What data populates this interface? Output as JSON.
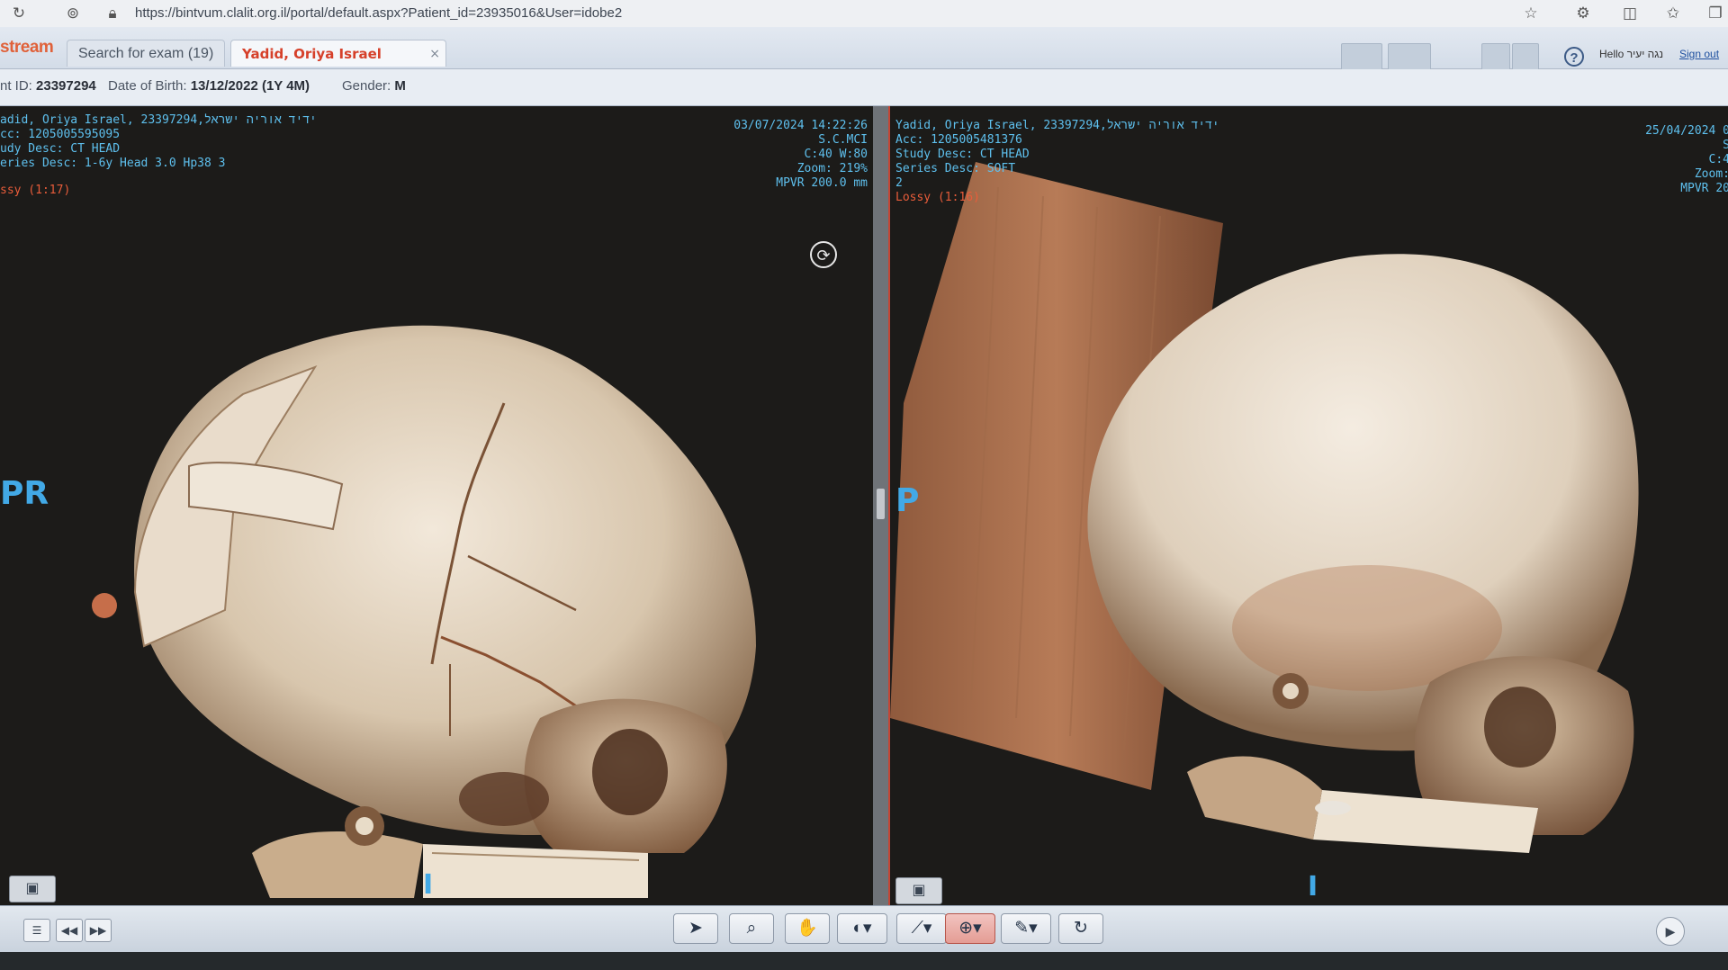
{
  "browser": {
    "url": "https://bintvum.clalit.org.il/portal/default.aspx?Patient_id=23935016&User=idobe2",
    "icons": [
      "refresh-icon",
      "site-icon",
      "lock-icon",
      "star-icon",
      "extensions-icon",
      "split-screen-icon",
      "favorites-icon",
      "collections-icon"
    ]
  },
  "app": {
    "logo": "stream",
    "tabs": [
      {
        "label": "Search for exam (19)"
      },
      {
        "label": "Yadid, Oriya Israel",
        "close": "×"
      }
    ],
    "help": "?",
    "hello": "Hello נגה יעיר",
    "sign_out": "Sign out"
  },
  "patient": {
    "id_label": "nt ID:",
    "id_value": "23397294",
    "dob_label": "Date of Birth:",
    "dob_value": "13/12/2022 (1Y 4M)",
    "gender_label": "Gender:",
    "gender_value": "M"
  },
  "viewer_left": {
    "line1": "adid, Oriya Israel, 23397294,ידיד אוריה ישראל",
    "line2": "cc: 1205005595095",
    "line3": "udy Desc: CT HEAD",
    "line4": "eries Desc: 1-6y Head  3.0  Hp38  3",
    "lossy": "ssy (1:17)",
    "date": "03/07/2024 14:22:26",
    "station": "S.C.MCI",
    "window": "C:40 W:80",
    "zoom": "Zoom: 219%",
    "mpvr": "MPVR 200.0 mm",
    "orient_left": "PR",
    "orient_bottom": "I",
    "button": "▣"
  },
  "viewer_right": {
    "line1": "Yadid, Oriya Israel, 23397294,ידיד אוריה ישראל",
    "line2": "Acc: 1205005481376",
    "line3": "Study Desc: CT HEAD",
    "line4": "Series Desc: SOFT",
    "line5": "2",
    "lossy": "Lossy (1:16)",
    "date": "25/04/2024 0",
    "station": "S",
    "window": "C:4",
    "zoom": "Zoom:",
    "mpvr": "MPVR 20",
    "orient_left": "P",
    "orient_bottom": "I",
    "button": "▣"
  },
  "toolbar": {
    "list": "☰",
    "prev": "◀◀",
    "next": "▶▶",
    "tools": [
      {
        "name": "pointer-tool",
        "glyph": "➤"
      },
      {
        "name": "zoom-tool",
        "glyph": "⌕"
      },
      {
        "name": "pan-tool",
        "glyph": "✋"
      },
      {
        "name": "window-level-tool",
        "glyph": "◐▾"
      },
      {
        "name": "measure-tool",
        "glyph": "⟋▾"
      },
      {
        "name": "rotate-3d-tool",
        "glyph": "⊕▾"
      },
      {
        "name": "annotate-tool",
        "glyph": "✎▾"
      },
      {
        "name": "reset-tool",
        "glyph": "↻"
      }
    ],
    "play": "▶"
  },
  "colors": {
    "overlay_text": "#5ec0ee",
    "lossy_text": "#e85c3a",
    "active_border": "#c44635",
    "bone": "#e8dccb"
  }
}
